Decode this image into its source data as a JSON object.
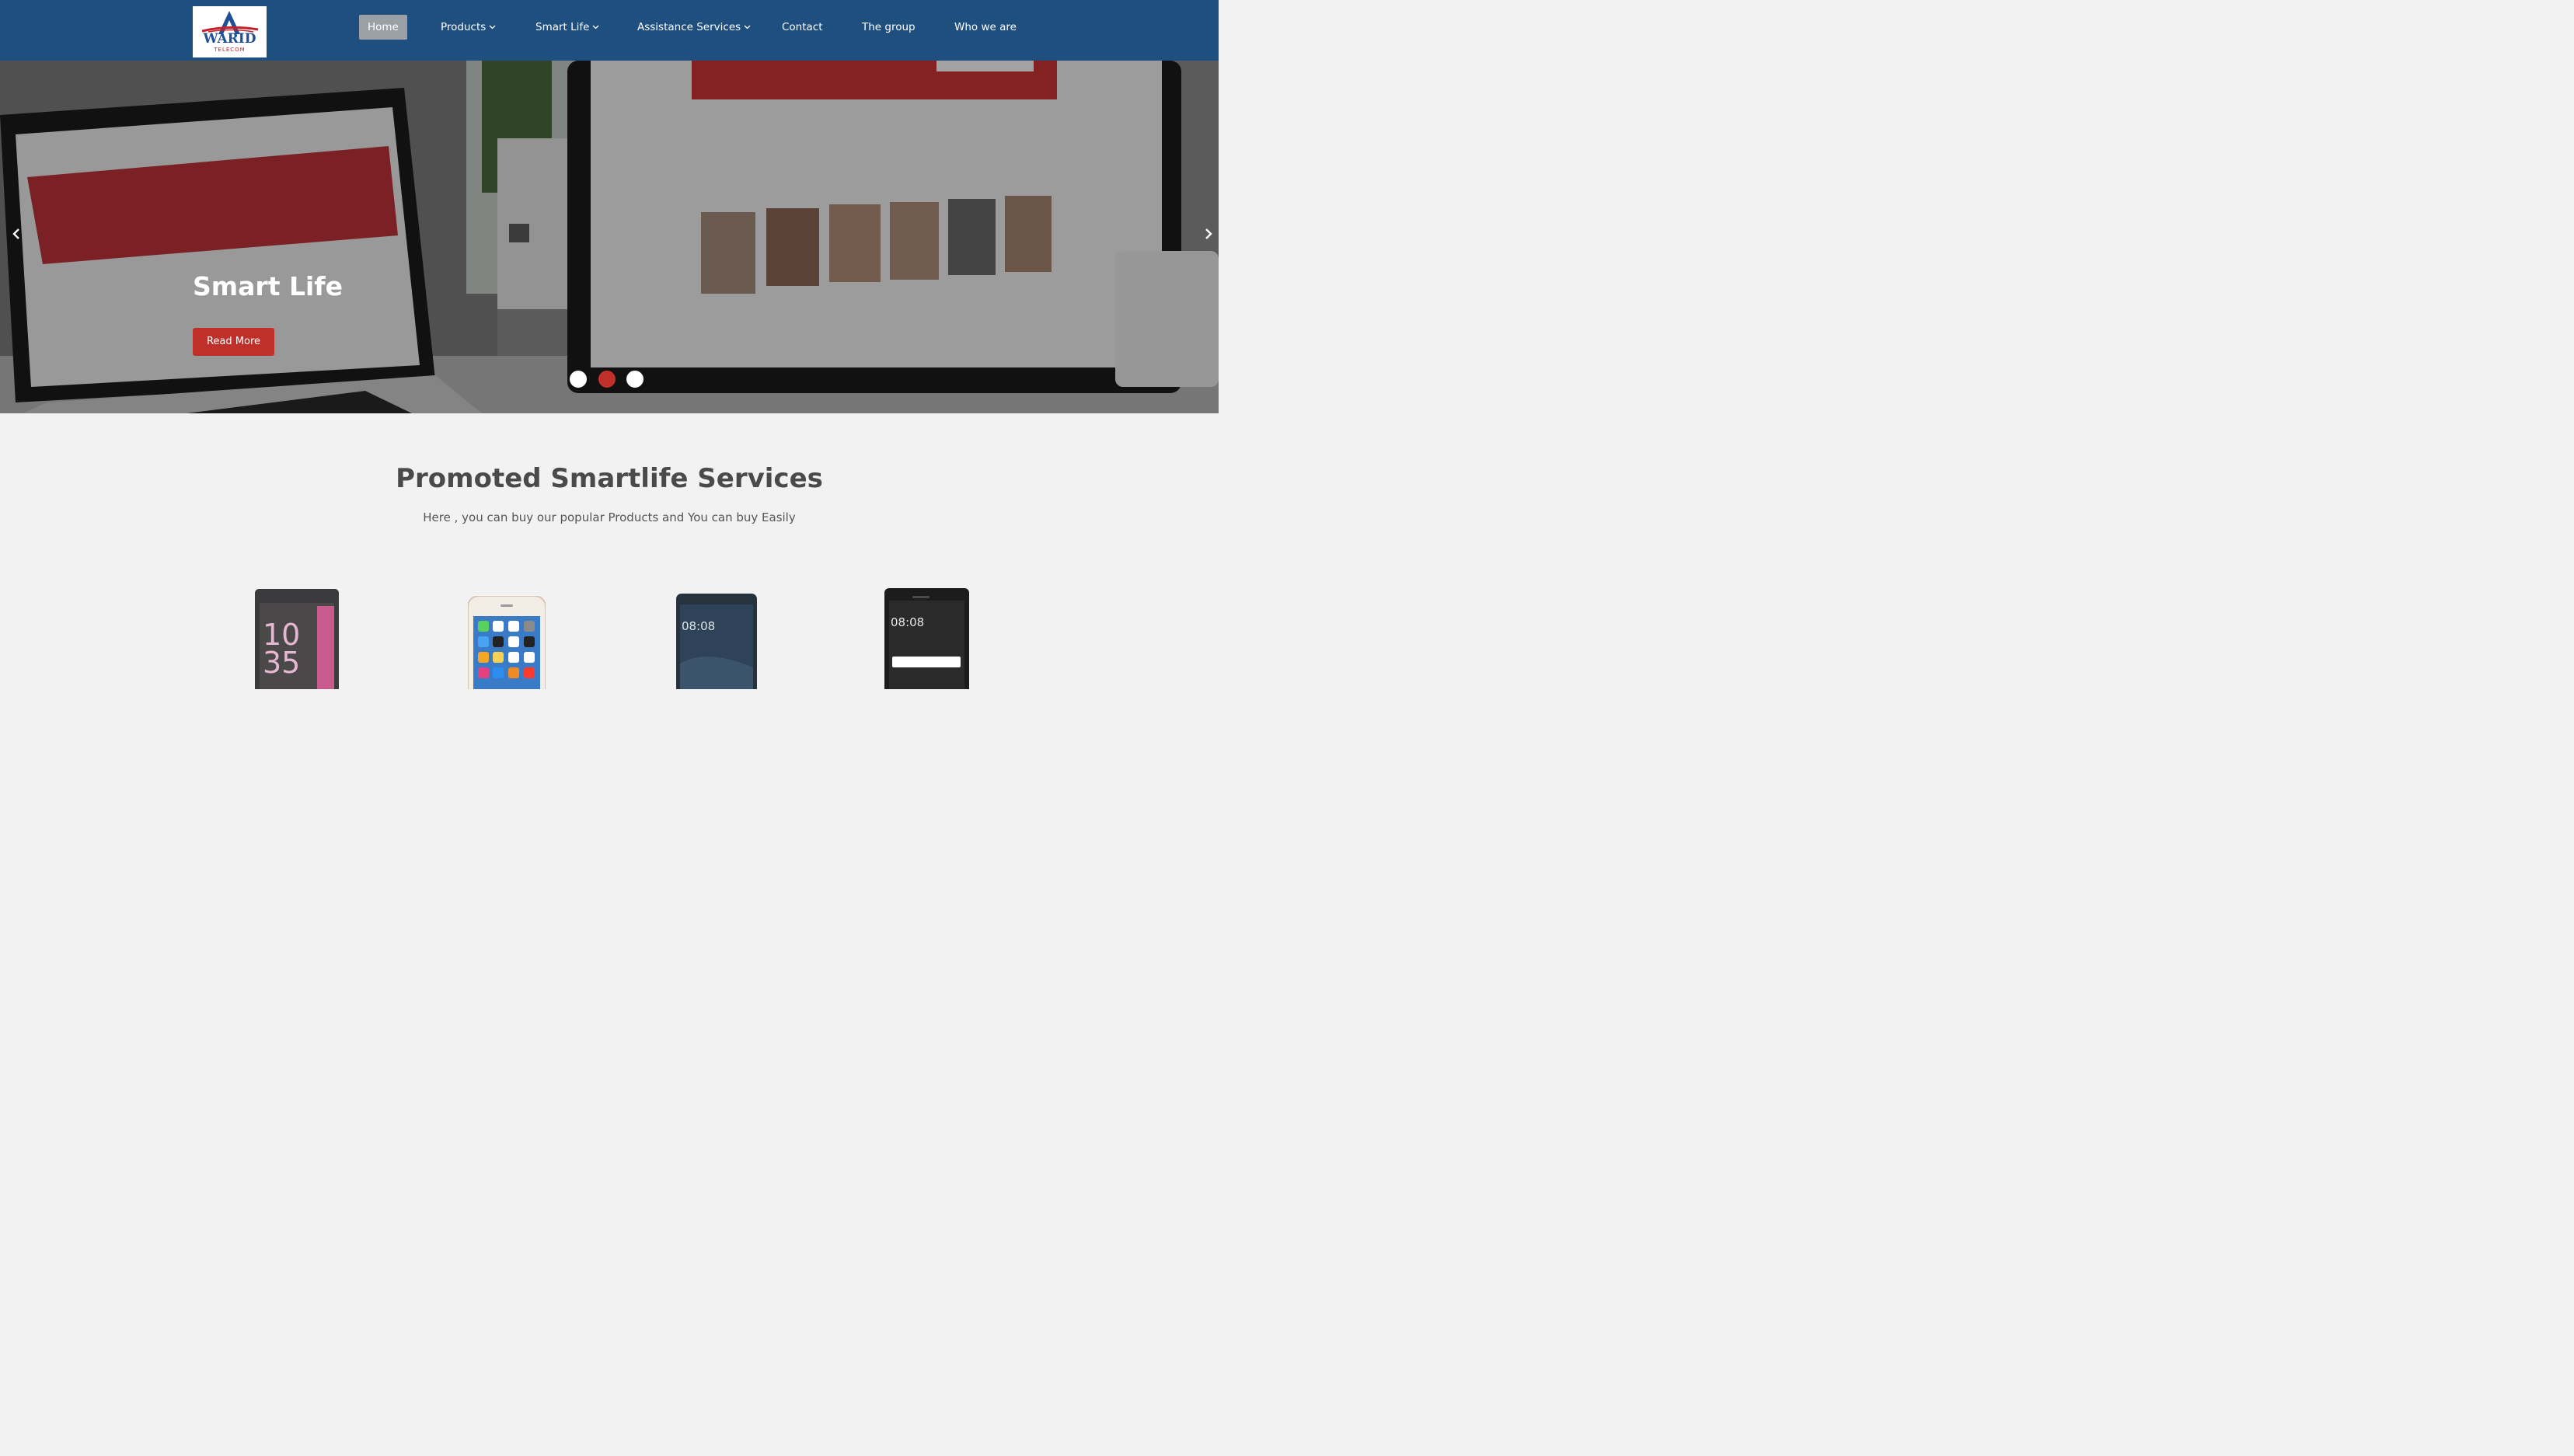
{
  "brand": {
    "logo_text": "WARID",
    "logo_subtext": "TELECOM"
  },
  "nav": {
    "items": [
      {
        "label": "Home",
        "active": true,
        "dropdown": false
      },
      {
        "label": "Products",
        "active": false,
        "dropdown": true
      },
      {
        "label": "Smart Life",
        "active": false,
        "dropdown": true
      },
      {
        "label": "Assistance Services",
        "active": false,
        "dropdown": true
      },
      {
        "label": "Contact",
        "active": false,
        "dropdown": false
      },
      {
        "label": "The group",
        "active": false,
        "dropdown": false
      },
      {
        "label": "Who we are",
        "active": false,
        "dropdown": false
      }
    ]
  },
  "hero": {
    "title": "Smart Life",
    "button_label": "Read More",
    "slide_count": 3,
    "active_slide": 2,
    "prev_icon": "chevron-left-icon",
    "next_icon": "chevron-right-icon"
  },
  "promo": {
    "title": "Promoted Smartlife Services",
    "subtitle": "Here , you can buy our popular Products and You can buy Easily",
    "phone_screens": [
      {
        "clock": "10\n35"
      },
      {
        "clock": ""
      },
      {
        "clock": "08:08"
      },
      {
        "clock": "08:08"
      }
    ]
  },
  "colors": {
    "header": "#1f4f7f",
    "accent_red": "#c0302a",
    "page_bg": "#f2f2f2",
    "active_nav": "#9aa0a6"
  }
}
